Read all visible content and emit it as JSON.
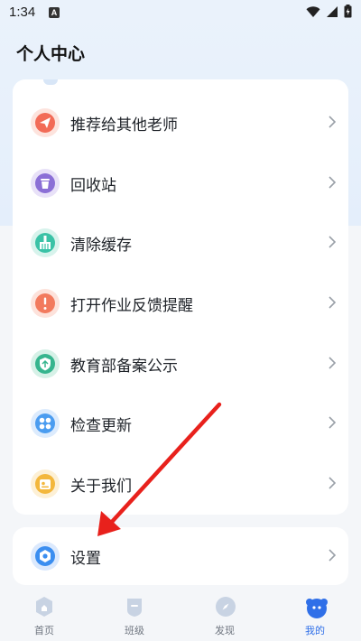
{
  "status_bar": {
    "time": "1:34",
    "notif_glyph": "A"
  },
  "header": {
    "title": "个人中心"
  },
  "menu": {
    "items": [
      {
        "label": "推荐给其他老师",
        "icon": "paper-plane-icon",
        "color": "#f26b57"
      },
      {
        "label": "回收站",
        "icon": "trash-icon",
        "color": "#8b6fd6"
      },
      {
        "label": "清除缓存",
        "icon": "broom-icon",
        "color": "#39c2a6"
      },
      {
        "label": "打开作业反馈提醒",
        "icon": "alert-icon",
        "color": "#f27a5e"
      },
      {
        "label": "教育部备案公示",
        "icon": "shield-icon",
        "color": "#36b58e"
      },
      {
        "label": "检查更新",
        "icon": "update-icon",
        "color": "#4a9cf0"
      },
      {
        "label": "关于我们",
        "icon": "info-card-icon",
        "color": "#f3b73c"
      }
    ]
  },
  "settings": {
    "label": "设置",
    "icon": "settings-hex-icon",
    "color": "#3b8ef0"
  },
  "tabbar": {
    "tabs": [
      {
        "label": "首页",
        "icon": "home-icon",
        "active": false
      },
      {
        "label": "班级",
        "icon": "class-icon",
        "active": false
      },
      {
        "label": "发现",
        "icon": "discover-icon",
        "active": false
      },
      {
        "label": "我的",
        "icon": "mine-icon",
        "active": true
      }
    ]
  },
  "colors": {
    "accent": "#2f6fe8",
    "annotation_arrow": "#e8211c"
  }
}
